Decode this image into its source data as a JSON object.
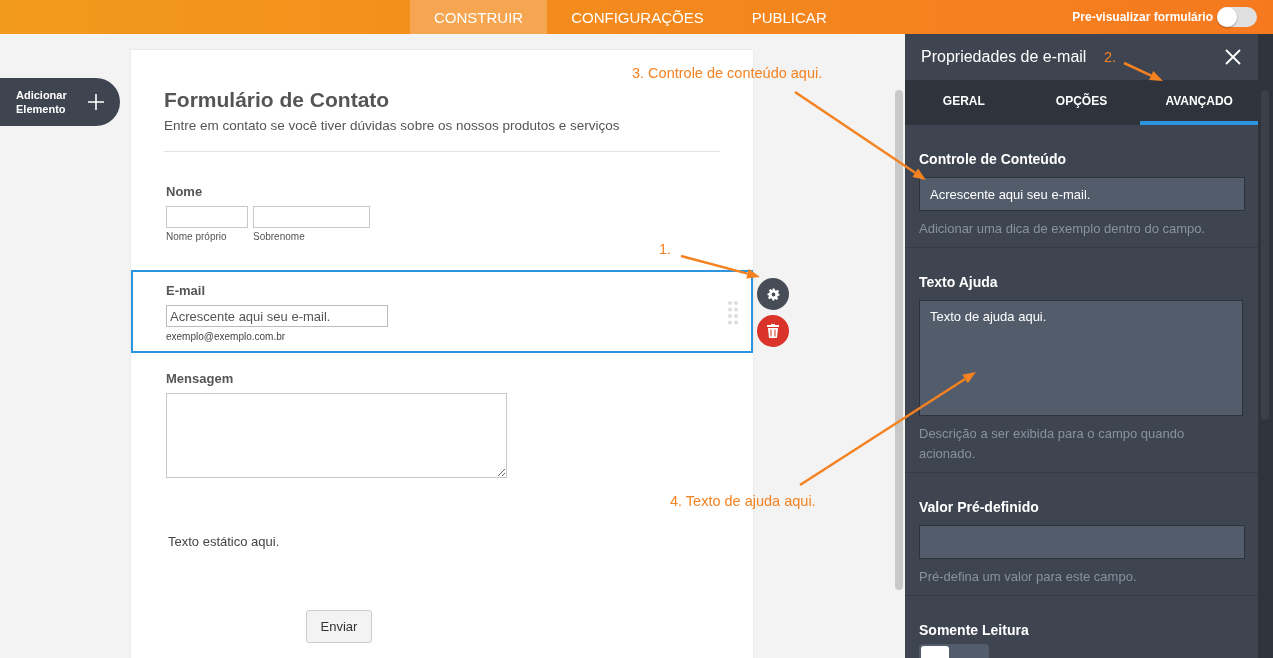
{
  "topbar": {
    "tabs": [
      {
        "label": "CONSTRUIR",
        "selected": true
      },
      {
        "label": "CONFIGURAÇÕES",
        "selected": false
      },
      {
        "label": "PUBLICAR",
        "selected": false
      }
    ],
    "preview": {
      "label": "Pre-visualizar formulário",
      "on": false
    }
  },
  "add_element_button": {
    "label": "Adicionar Elemento"
  },
  "form": {
    "title": "Formulário de Contato",
    "subtitle": "Entre em contato se você tiver dúvidas sobre os nossos produtos e serviços",
    "fields": [
      {
        "kind": "name",
        "label": "Nome",
        "sublabels": [
          "Nome próprio",
          "Sobrenome"
        ],
        "selected": false
      },
      {
        "kind": "email",
        "label": "E-mail",
        "placeholder": "Acrescente aqui seu e-mail.",
        "hint": "exemplo@exemplo.com.br",
        "selected": true
      },
      {
        "kind": "textarea",
        "label": "Mensagem",
        "selected": false
      },
      {
        "kind": "text",
        "text": "Texto estático aqui.",
        "selected": false
      },
      {
        "kind": "button",
        "label": "Enviar",
        "selected": false
      }
    ]
  },
  "panel": {
    "title": "Propriedades de e-mail",
    "tabs": [
      {
        "label": "GERAL",
        "selected": false
      },
      {
        "label": "OPÇÕES",
        "selected": false
      },
      {
        "label": "AVANÇADO",
        "selected": true
      }
    ],
    "sections": [
      {
        "kind": "input",
        "label": "Controle de Conteúdo",
        "value": "Acrescente aqui seu e-mail.",
        "hint": "Adicionar uma dica de exemplo dentro do campo."
      },
      {
        "kind": "textarea",
        "label": "Texto Ajuda",
        "value": "Texto de ajuda aqui.",
        "hint": "Descrição a ser exibida para o campo quando acionado."
      },
      {
        "kind": "input",
        "label": "Valor Pré-definido",
        "hint": "Pré-defina um valor para este campo."
      },
      {
        "kind": "toggle",
        "label": "Somente Leitura",
        "on": false
      }
    ]
  },
  "annotations": [
    {
      "text": "1."
    },
    {
      "text": "2."
    },
    {
      "text": "3. Controle de conteúdo aqui."
    },
    {
      "text": "4. Texto de ajuda aqui."
    }
  ]
}
